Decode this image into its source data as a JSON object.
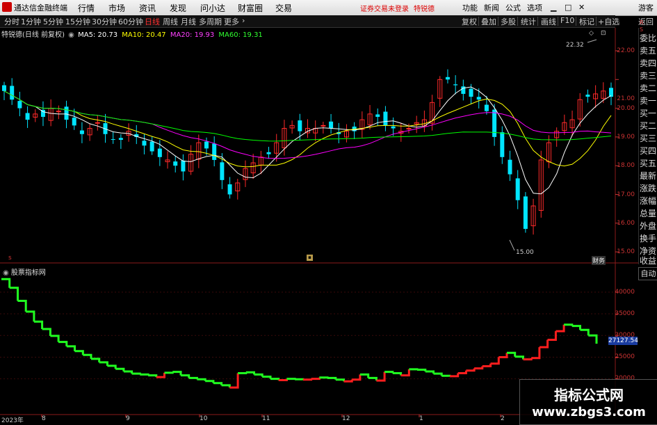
{
  "app": {
    "title": "通达信金融终端",
    "status": "证券交易未登录",
    "stock_name_red": "特锐德",
    "right_buttons": [
      "功能",
      "新闻",
      "公式",
      "选项"
    ],
    "guest": "游客"
  },
  "menu": [
    "行情",
    "市场",
    "资讯",
    "发现",
    "问小达",
    "财富圈",
    "交易"
  ],
  "periods": [
    "分时",
    "1分钟",
    "5分钟",
    "15分钟",
    "30分钟",
    "60分钟",
    "日线",
    "周线",
    "月线",
    "多周期",
    "更多"
  ],
  "tools": [
    "复权",
    "叠加",
    "多股",
    "统计",
    "画线",
    "F10",
    "标记",
    "+自选",
    "返回"
  ],
  "ma": {
    "title": "特锐德(日线 前复权)",
    "ma5": "MA5: 20.73",
    "ma10": "MA10: 20.47",
    "ma20": "MA20: 19.93",
    "ma60": "MA60: 19.31"
  },
  "right_panel": [
    "委比",
    "卖五",
    "卖四",
    "卖三",
    "卖二",
    "卖一",
    "买一",
    "买二",
    "买三",
    "买四",
    "买五",
    "最新",
    "涨跌",
    "涨幅",
    "总量",
    "外盘",
    "换手",
    "净资",
    "收益"
  ],
  "price_axis": [
    "22.00",
    "21.00",
    "20.00",
    "19.00",
    "18.00",
    "17.00",
    "16.00",
    "15.00"
  ],
  "annotations": {
    "high": "22.32",
    "low": "15.00",
    "caiwu": "财务"
  },
  "indicator": {
    "title": "股票指标网",
    "auto": "自动",
    "current": "27127.54",
    "axis": [
      "40000",
      "35000",
      "30000",
      "25000",
      "20000"
    ]
  },
  "dates": [
    "2023年",
    "8",
    "9",
    "10",
    "11",
    "12",
    "1",
    "2"
  ],
  "watermark": {
    "line1": "指标公式网",
    "line2": "www.zbgs3.com"
  },
  "colors": {
    "up": "#ff2a2a",
    "down": "#00e5ff",
    "ma5": "#ffffff",
    "ma10": "#ffff00",
    "ma20": "#ff00ff",
    "ma60": "#00ff00",
    "ind_up": "#ff1e1e",
    "ind_down": "#20ff20"
  },
  "chart_data": [
    {
      "type": "candlestick",
      "title": "特锐德(日线 前复权)",
      "ylim": [
        15,
        22.3
      ],
      "y": [
        20.6,
        20.3,
        20.0,
        19.6,
        19.8,
        19.7,
        20.0,
        19.9,
        19.6,
        19.4,
        19.1,
        19.3,
        19.5,
        19.1,
        18.9,
        18.9,
        19.2,
        19.0,
        18.7,
        18.5,
        18.3,
        18.2,
        18.0,
        17.8,
        18.4,
        18.8,
        18.6,
        18.2,
        17.5,
        17.0,
        17.4,
        17.9,
        18.1,
        18.3,
        18.4,
        18.8,
        19.3,
        19.4,
        19.2,
        19.3,
        19.3,
        19.4,
        19.3,
        19.1,
        19.2,
        19.2,
        19.6,
        19.8,
        19.7,
        19.4,
        19.3,
        19.2,
        19.3,
        19.5,
        19.6,
        20.2,
        21.0,
        21.0,
        20.8,
        20.5,
        20.4,
        20.3,
        19.9,
        19.0,
        18.3,
        17.7,
        16.8,
        15.8,
        16.6,
        18.2,
        18.8,
        19.2,
        19.5,
        19.6,
        20.3,
        20.4,
        20.5,
        20.6,
        20.4
      ],
      "ma": [
        {
          "name": "MA5",
          "value": 20.73
        },
        {
          "name": "MA10",
          "value": 20.47
        },
        {
          "name": "MA20",
          "value": 19.93
        },
        {
          "name": "MA60",
          "value": 19.31
        }
      ]
    },
    {
      "type": "line",
      "title": "股票指标网",
      "ylim": [
        16000,
        44000
      ],
      "current": 27127.54,
      "y": [
        43000,
        41000,
        38000,
        35500,
        33200,
        31500,
        29900,
        28500,
        27500,
        26400,
        25500,
        24600,
        23800,
        23000,
        22300,
        21700,
        21200,
        21000,
        20800,
        20400,
        21400,
        21600,
        20800,
        20200,
        19900,
        19500,
        19000,
        18500,
        18000,
        21300,
        21500,
        21000,
        20500,
        20000,
        19700,
        20000,
        19900,
        19800,
        20000,
        20300,
        20200,
        19800,
        19400,
        19800,
        21000,
        20200,
        19600,
        21600,
        21300,
        20800,
        22200,
        22100,
        21700,
        21200,
        20700,
        20600,
        21300,
        21900,
        22400,
        22900,
        23500,
        25000,
        26000,
        25100,
        24500,
        24800,
        27300,
        29000,
        31000,
        32500,
        32200,
        31300,
        30000,
        28100
      ],
      "up": [
        0,
        0,
        0,
        0,
        0,
        0,
        0,
        0,
        0,
        0,
        0,
        0,
        0,
        0,
        0,
        0,
        0,
        0,
        0,
        0,
        1,
        0,
        0,
        0,
        0,
        0,
        0,
        0,
        0,
        1,
        0,
        0,
        0,
        0,
        0,
        1,
        0,
        0,
        1,
        1,
        0,
        0,
        0,
        1,
        1,
        0,
        0,
        1,
        0,
        0,
        1,
        0,
        0,
        0,
        0,
        0,
        1,
        1,
        1,
        1,
        1,
        1,
        1,
        0,
        0,
        1,
        1,
        1,
        1,
        1,
        0,
        0,
        0,
        0
      ]
    }
  ]
}
